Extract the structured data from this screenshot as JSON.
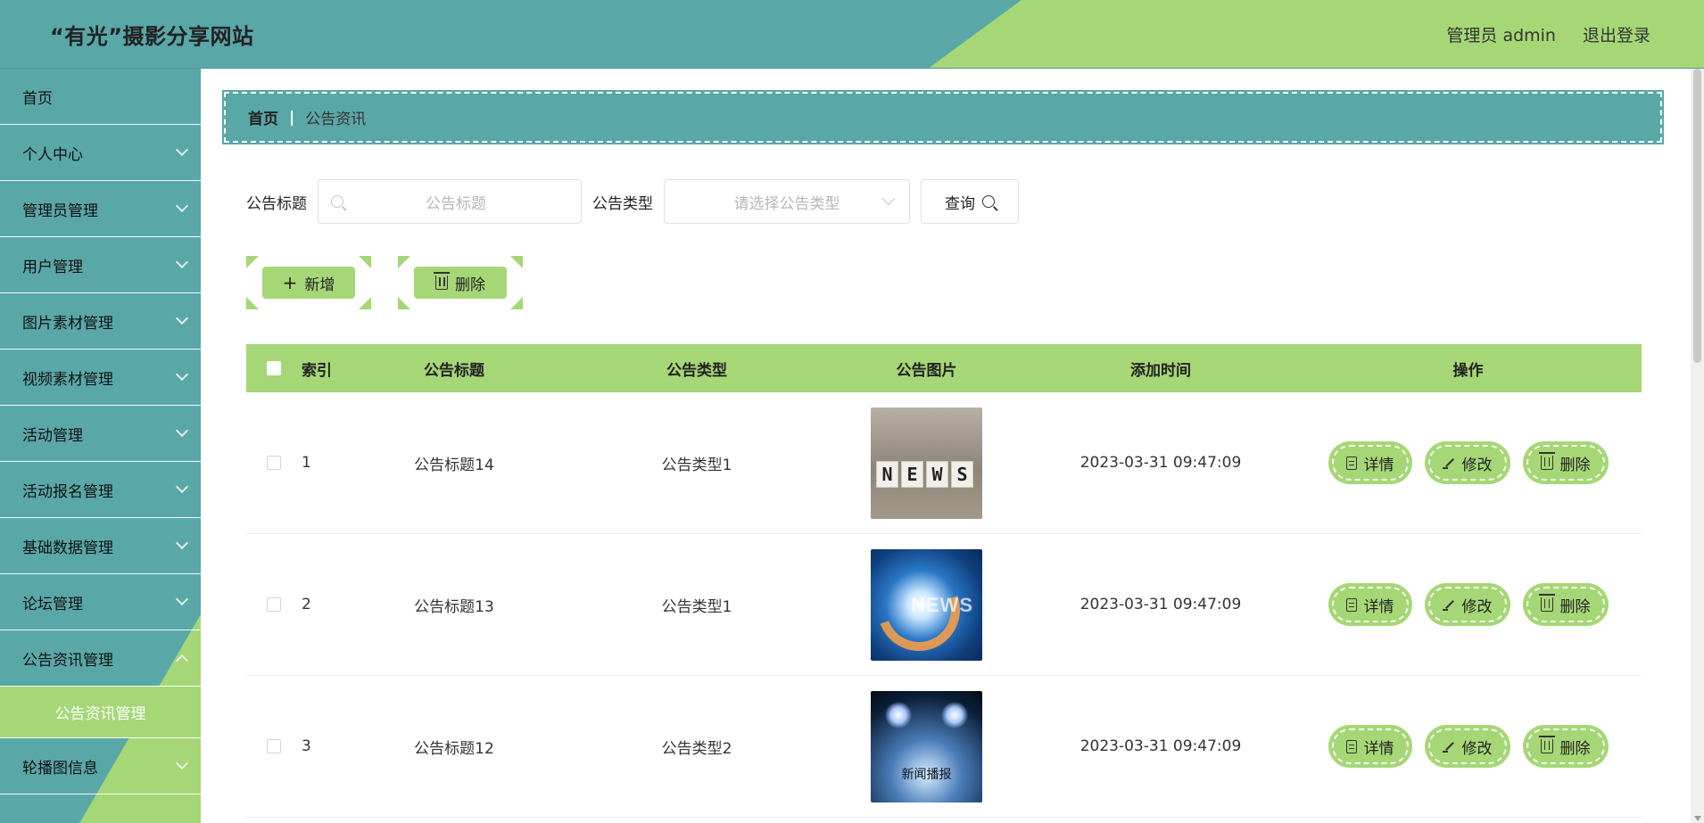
{
  "header": {
    "site_title": "“有光”摄影分享网站",
    "user_label": "管理员 admin",
    "logout_label": "退出登录"
  },
  "sidebar": {
    "items": [
      {
        "label": "首页",
        "has_children": false
      },
      {
        "label": "个人中心",
        "has_children": true
      },
      {
        "label": "管理员管理",
        "has_children": true
      },
      {
        "label": "用户管理",
        "has_children": true
      },
      {
        "label": "图片素材管理",
        "has_children": true
      },
      {
        "label": "视频素材管理",
        "has_children": true
      },
      {
        "label": "活动管理",
        "has_children": true
      },
      {
        "label": "活动报名管理",
        "has_children": true
      },
      {
        "label": "基础数据管理",
        "has_children": true
      },
      {
        "label": "论坛管理",
        "has_children": true
      },
      {
        "label": "公告资讯管理",
        "has_children": true,
        "expanded": true
      },
      {
        "label": "轮播图信息",
        "has_children": true
      }
    ],
    "submenu_active": "公告资讯管理"
  },
  "breadcrumb": {
    "home": "首页",
    "separator": "|",
    "current": "公告资讯"
  },
  "filters": {
    "title_label": "公告标题",
    "title_placeholder": "公告标题",
    "type_label": "公告类型",
    "type_placeholder": "请选择公告类型",
    "query_label": "查询"
  },
  "actions": {
    "add_label": "新增",
    "delete_label": "删除"
  },
  "table": {
    "headers": [
      "索引",
      "公告标题",
      "公告类型",
      "公告图片",
      "添加时间",
      "操作"
    ],
    "rows": [
      {
        "index": "1",
        "title": "公告标题14",
        "type": "公告类型1",
        "image_icon": "news-blocks-image",
        "time": "2023-03-31 09:47:09"
      },
      {
        "index": "2",
        "title": "公告标题13",
        "type": "公告类型1",
        "image_icon": "news-swirl-image",
        "image_text": "NEWS",
        "time": "2023-03-31 09:47:09"
      },
      {
        "index": "3",
        "title": "公告标题12",
        "type": "公告类型2",
        "image_icon": "stage-spotlight-image",
        "image_text": "新闻播报",
        "time": "2023-03-31 09:47:09"
      }
    ],
    "row_actions": {
      "detail": "详情",
      "edit": "修改",
      "delete": "删除"
    }
  },
  "images": {
    "news_blocks_letters": [
      "N",
      "E",
      "W",
      "S"
    ]
  },
  "colors": {
    "teal": "#5aa7a8",
    "green": "#a6d776"
  }
}
